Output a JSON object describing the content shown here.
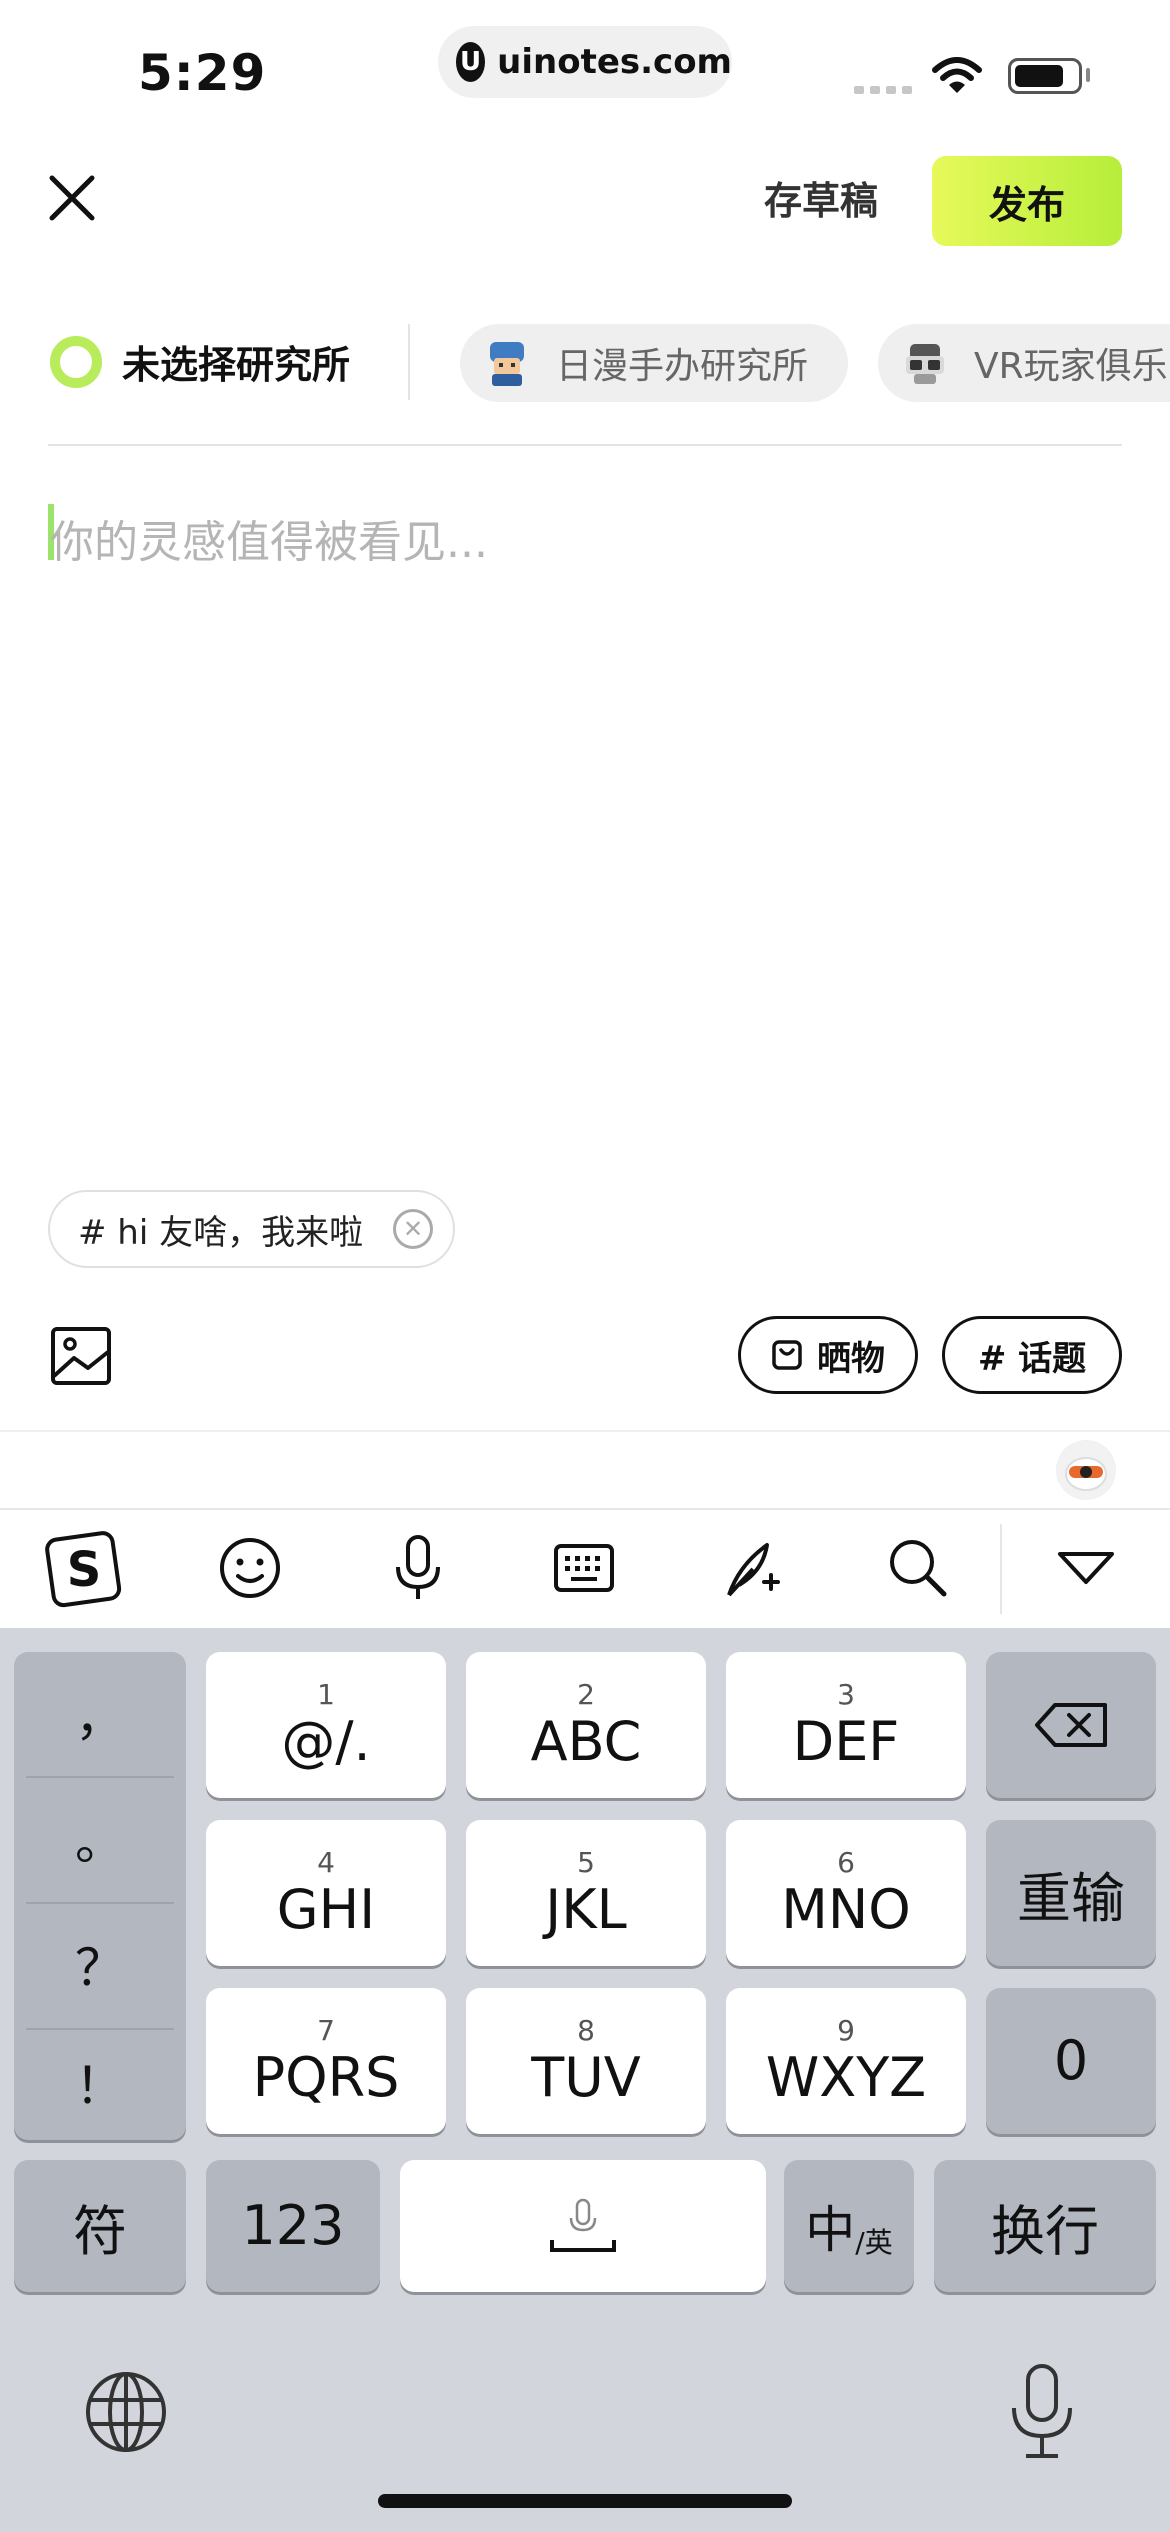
{
  "status_bar": {
    "time": "5:29",
    "url": "uinotes.com",
    "url_logo": "U"
  },
  "header": {
    "close_icon": "close-icon",
    "draft_label": "存草稿",
    "publish_label": "发布",
    "publish_color": "#d6f44a"
  },
  "institutes": {
    "none_label": "未选择研究所",
    "chips": [
      {
        "label": "日漫手办研究所",
        "icon": "figure-avatar-icon"
      },
      {
        "label": "VR玩家俱乐",
        "icon": "vr-headset-icon"
      }
    ]
  },
  "editor": {
    "placeholder": "你的灵感值得被看见..."
  },
  "topic": {
    "label": "# hi 友啥，我来啦"
  },
  "toolbar": {
    "image_icon": "image-icon",
    "shaiwu_label": "晒物",
    "huati_label": "# 话题"
  },
  "ime_toolbar": {
    "icons": [
      "sogou-logo-icon",
      "emoji-icon",
      "microphone-icon",
      "keyboard-icon",
      "feather-ai-icon",
      "search-icon",
      "collapse-keyboard-icon"
    ]
  },
  "keyboard": {
    "punctuation": [
      "，",
      "。",
      "？",
      "！"
    ],
    "keys": [
      {
        "num": "1",
        "label": "@/."
      },
      {
        "num": "2",
        "label": "ABC"
      },
      {
        "num": "3",
        "label": "DEF"
      },
      {
        "num": "4",
        "label": "GHI"
      },
      {
        "num": "5",
        "label": "JKL"
      },
      {
        "num": "6",
        "label": "MNO"
      },
      {
        "num": "7",
        "label": "PQRS"
      },
      {
        "num": "8",
        "label": "TUV"
      },
      {
        "num": "9",
        "label": "WXYZ"
      }
    ],
    "reset_label": "重输",
    "zero_label": "0",
    "symbol_label": "符",
    "numeric_label": "123",
    "lang_main": "中",
    "lang_sub": "/英",
    "return_label": "换行"
  }
}
